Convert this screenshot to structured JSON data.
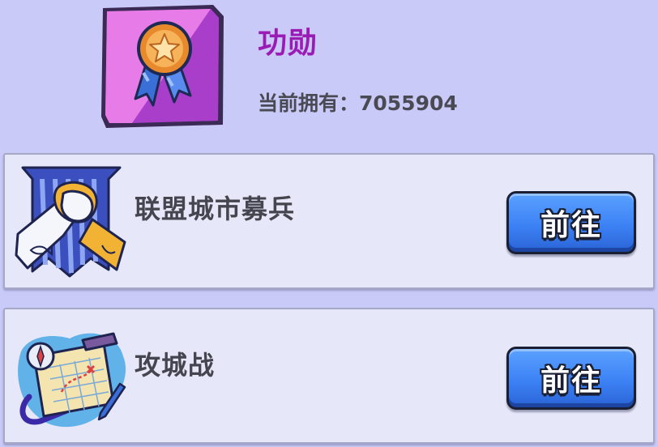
{
  "header": {
    "title": "功勋",
    "owned_label": "当前拥有：7055904",
    "icon": "medal-icon"
  },
  "cards": [
    {
      "title": "联盟城市募兵",
      "button_label": "前往",
      "icon": "arm-wrestle-banner-icon"
    },
    {
      "title": "攻城战",
      "button_label": "前往",
      "icon": "battle-map-icon"
    }
  ],
  "colors": {
    "background": "#c9caf7",
    "card_bg": "#e6e7f8",
    "title_purple": "#9b1bb5",
    "button_blue": "#3c82f5"
  }
}
